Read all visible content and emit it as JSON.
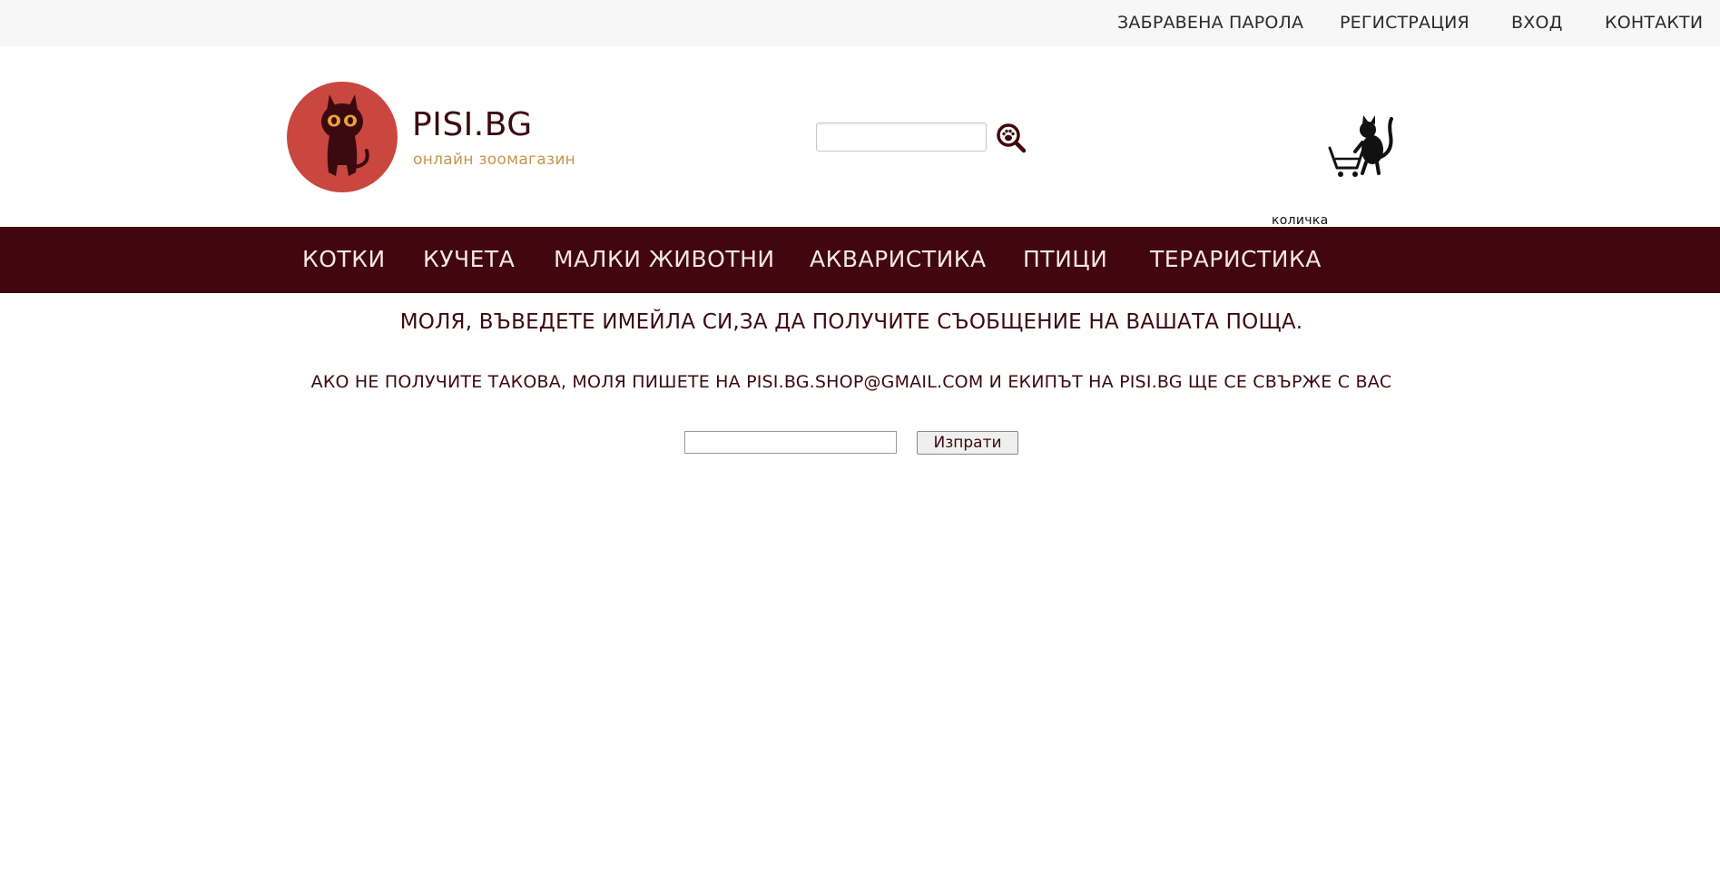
{
  "topbar": {
    "links": [
      {
        "label": "ЗАБРАВЕНА ПАРОЛА"
      },
      {
        "label": "РЕГИСТРАЦИЯ"
      },
      {
        "label": "ВХОД"
      },
      {
        "label": "КОНТАКТИ"
      }
    ]
  },
  "header": {
    "site_name": "PISI.BG",
    "tagline": "онлайн зоомагазин",
    "search": {
      "value": "",
      "placeholder": "",
      "icon": "paw-magnifier-icon"
    },
    "cart": {
      "label": "количка",
      "icon": "cat-cart-icon"
    }
  },
  "nav": {
    "items": [
      {
        "label": "КОТКИ"
      },
      {
        "label": "КУЧЕТА"
      },
      {
        "label": "МАЛКИ ЖИВОТНИ"
      },
      {
        "label": "АКВАРИСТИКА"
      },
      {
        "label": "ПТИЦИ"
      },
      {
        "label": "ТЕРАРИСТИКА"
      }
    ]
  },
  "main": {
    "heading": "МОЛЯ, ВЪВЕДЕТЕ ИМЕЙЛА СИ,ЗА ДА ПОЛУЧИТЕ СЪОБЩЕНИЕ НА ВАШАТА ПОЩА.",
    "subtext": "АКО НЕ ПОЛУЧИТЕ ТАКОВА, МОЛЯ ПИШЕТЕ НА PISI.BG.SHOP@GMAIL.COM И ЕКИПЪТ НА PISI.BG ЩЕ СЕ СВЪРЖЕ С ВАС",
    "email": {
      "value": "",
      "placeholder": ""
    },
    "submit_label": "Изпрати"
  },
  "colors": {
    "nav_bg": "#42060e",
    "logo_circle": "#c9473f",
    "tagline": "#c4964c",
    "text": "#3b0a10"
  }
}
